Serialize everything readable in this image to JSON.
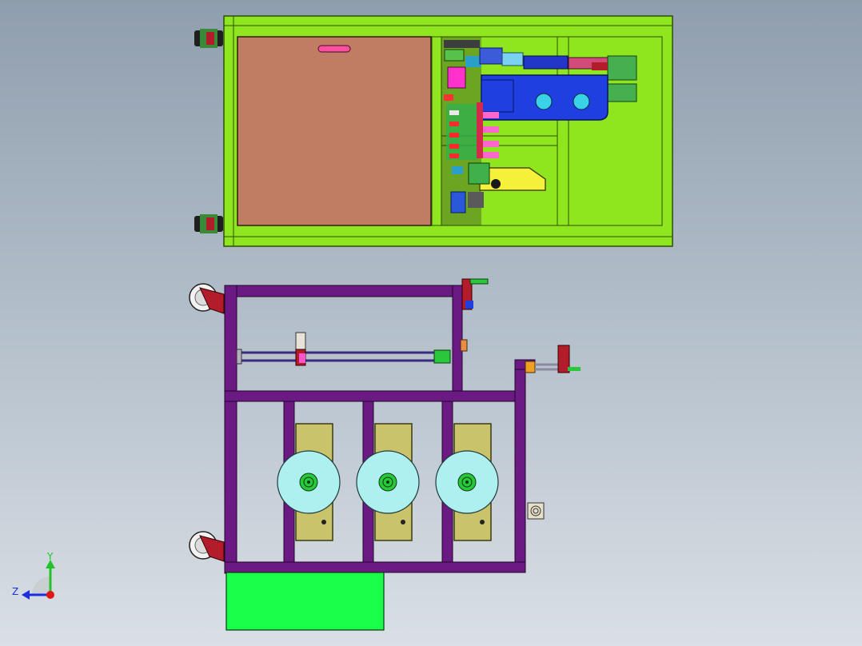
{
  "view": {
    "background_top": "#8f9eae",
    "background_bottom": "#d9dfe5"
  },
  "triad": {
    "y_label": "Y",
    "z_label": "Z",
    "y_color": "#22c32a",
    "z_color": "#1c2ee0",
    "origin_color": "#e01515"
  },
  "colors": {
    "top_frame": "#8fe61e",
    "top_frame_dark": "#5a9a10",
    "wood_panel": "#c07d63",
    "blue_plate": "#1f3fe0",
    "cyan_hole": "#39d2e6",
    "yellow_part": "#f5f03a",
    "magenta_part": "#ff4fd0",
    "purple_frame": "#6a1a82",
    "reel_disk": "#aef0f0",
    "reel_backing": "#c9c46c",
    "green_box": "#1aff4a",
    "caster_red": "#b31c2a",
    "caster_wheel": "#f2f2f2"
  }
}
